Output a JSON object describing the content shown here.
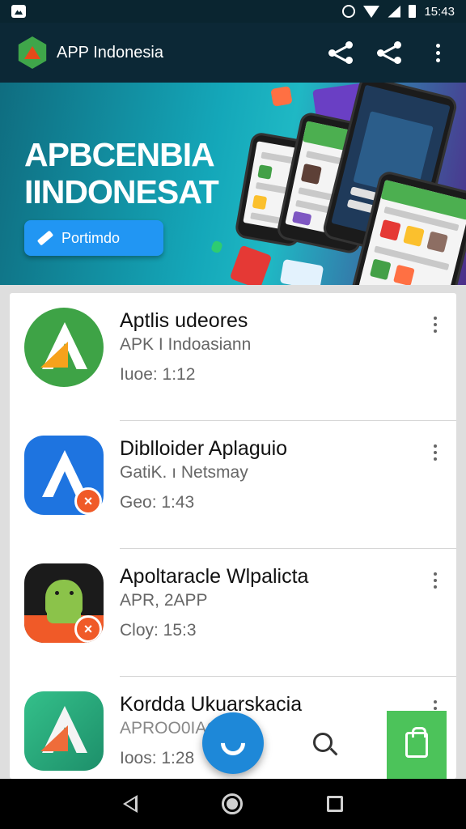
{
  "status_bar": {
    "time": "15:43"
  },
  "app_bar": {
    "title": "APP Indonesia"
  },
  "banner": {
    "title_line1": "APBCENBIA",
    "title_line2": "IINDONESAT",
    "cta_label": "Portimdo"
  },
  "apps": [
    {
      "name": "Aptlis udeores",
      "subtitle": "APK I Indoasiann",
      "meta": "Iuoe: 1:12",
      "icon": "a-logo-icon"
    },
    {
      "name": "Diblloider Aplaguio",
      "subtitle": "GatiK. ı Netsmay",
      "meta": "Geo: 1:43",
      "icon": "a-logo-remove-icon"
    },
    {
      "name": "Apoltaracle Wlpalicta",
      "subtitle": "APR, 2APP",
      "meta": "Cloy: 15:3",
      "icon": "android-icon"
    },
    {
      "name": "Kordda Ukuarskacia",
      "subtitle": "APROO0IAOI",
      "meta": "Ioos: 1:28",
      "icon": "a-gradient-icon"
    }
  ],
  "colors": {
    "app_bar": "#0c2836",
    "accent_blue": "#2196f3",
    "accent_green": "#4cc35a",
    "remove_badge": "#f05a28"
  }
}
